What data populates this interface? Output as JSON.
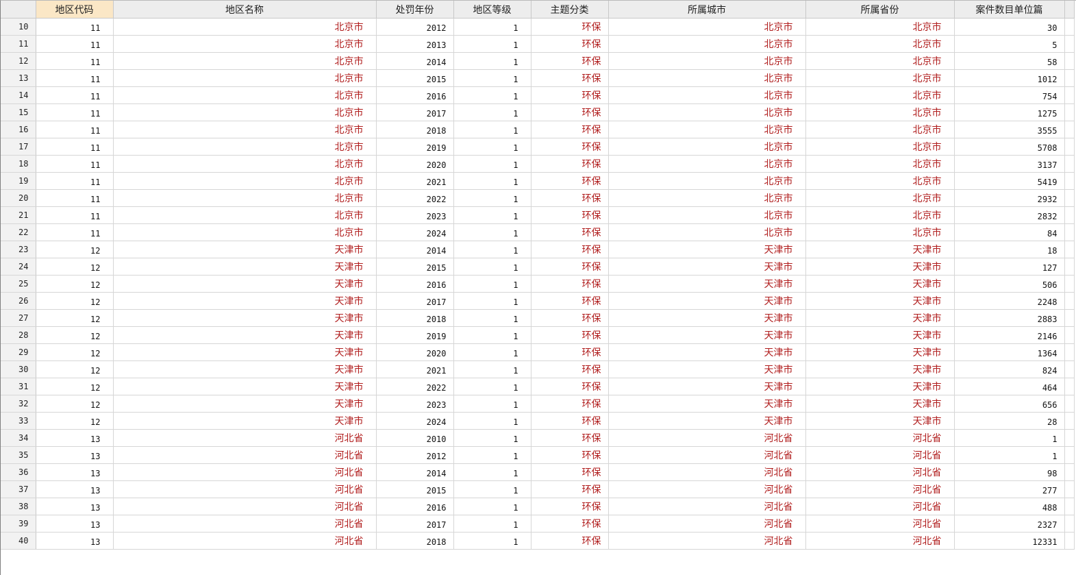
{
  "columns": [
    "地区代码",
    "地区名称",
    "处罚年份",
    "地区等级",
    "主题分类",
    "所属城市",
    "所属省份",
    "案件数目单位篇"
  ],
  "rows": [
    {
      "n": "10",
      "code": "11",
      "name": "北京市",
      "year": "2012",
      "level": "1",
      "theme": "环保",
      "city": "北京市",
      "prov": "北京市",
      "count": "30"
    },
    {
      "n": "11",
      "code": "11",
      "name": "北京市",
      "year": "2013",
      "level": "1",
      "theme": "环保",
      "city": "北京市",
      "prov": "北京市",
      "count": "5"
    },
    {
      "n": "12",
      "code": "11",
      "name": "北京市",
      "year": "2014",
      "level": "1",
      "theme": "环保",
      "city": "北京市",
      "prov": "北京市",
      "count": "58"
    },
    {
      "n": "13",
      "code": "11",
      "name": "北京市",
      "year": "2015",
      "level": "1",
      "theme": "环保",
      "city": "北京市",
      "prov": "北京市",
      "count": "1012"
    },
    {
      "n": "14",
      "code": "11",
      "name": "北京市",
      "year": "2016",
      "level": "1",
      "theme": "环保",
      "city": "北京市",
      "prov": "北京市",
      "count": "754"
    },
    {
      "n": "15",
      "code": "11",
      "name": "北京市",
      "year": "2017",
      "level": "1",
      "theme": "环保",
      "city": "北京市",
      "prov": "北京市",
      "count": "1275"
    },
    {
      "n": "16",
      "code": "11",
      "name": "北京市",
      "year": "2018",
      "level": "1",
      "theme": "环保",
      "city": "北京市",
      "prov": "北京市",
      "count": "3555"
    },
    {
      "n": "17",
      "code": "11",
      "name": "北京市",
      "year": "2019",
      "level": "1",
      "theme": "环保",
      "city": "北京市",
      "prov": "北京市",
      "count": "5708"
    },
    {
      "n": "18",
      "code": "11",
      "name": "北京市",
      "year": "2020",
      "level": "1",
      "theme": "环保",
      "city": "北京市",
      "prov": "北京市",
      "count": "3137"
    },
    {
      "n": "19",
      "code": "11",
      "name": "北京市",
      "year": "2021",
      "level": "1",
      "theme": "环保",
      "city": "北京市",
      "prov": "北京市",
      "count": "5419"
    },
    {
      "n": "20",
      "code": "11",
      "name": "北京市",
      "year": "2022",
      "level": "1",
      "theme": "环保",
      "city": "北京市",
      "prov": "北京市",
      "count": "2932"
    },
    {
      "n": "21",
      "code": "11",
      "name": "北京市",
      "year": "2023",
      "level": "1",
      "theme": "环保",
      "city": "北京市",
      "prov": "北京市",
      "count": "2832"
    },
    {
      "n": "22",
      "code": "11",
      "name": "北京市",
      "year": "2024",
      "level": "1",
      "theme": "环保",
      "city": "北京市",
      "prov": "北京市",
      "count": "84"
    },
    {
      "n": "23",
      "code": "12",
      "name": "天津市",
      "year": "2014",
      "level": "1",
      "theme": "环保",
      "city": "天津市",
      "prov": "天津市",
      "count": "18"
    },
    {
      "n": "24",
      "code": "12",
      "name": "天津市",
      "year": "2015",
      "level": "1",
      "theme": "环保",
      "city": "天津市",
      "prov": "天津市",
      "count": "127"
    },
    {
      "n": "25",
      "code": "12",
      "name": "天津市",
      "year": "2016",
      "level": "1",
      "theme": "环保",
      "city": "天津市",
      "prov": "天津市",
      "count": "506"
    },
    {
      "n": "26",
      "code": "12",
      "name": "天津市",
      "year": "2017",
      "level": "1",
      "theme": "环保",
      "city": "天津市",
      "prov": "天津市",
      "count": "2248"
    },
    {
      "n": "27",
      "code": "12",
      "name": "天津市",
      "year": "2018",
      "level": "1",
      "theme": "环保",
      "city": "天津市",
      "prov": "天津市",
      "count": "2883"
    },
    {
      "n": "28",
      "code": "12",
      "name": "天津市",
      "year": "2019",
      "level": "1",
      "theme": "环保",
      "city": "天津市",
      "prov": "天津市",
      "count": "2146"
    },
    {
      "n": "29",
      "code": "12",
      "name": "天津市",
      "year": "2020",
      "level": "1",
      "theme": "环保",
      "city": "天津市",
      "prov": "天津市",
      "count": "1364"
    },
    {
      "n": "30",
      "code": "12",
      "name": "天津市",
      "year": "2021",
      "level": "1",
      "theme": "环保",
      "city": "天津市",
      "prov": "天津市",
      "count": "824"
    },
    {
      "n": "31",
      "code": "12",
      "name": "天津市",
      "year": "2022",
      "level": "1",
      "theme": "环保",
      "city": "天津市",
      "prov": "天津市",
      "count": "464"
    },
    {
      "n": "32",
      "code": "12",
      "name": "天津市",
      "year": "2023",
      "level": "1",
      "theme": "环保",
      "city": "天津市",
      "prov": "天津市",
      "count": "656"
    },
    {
      "n": "33",
      "code": "12",
      "name": "天津市",
      "year": "2024",
      "level": "1",
      "theme": "环保",
      "city": "天津市",
      "prov": "天津市",
      "count": "28"
    },
    {
      "n": "34",
      "code": "13",
      "name": "河北省",
      "year": "2010",
      "level": "1",
      "theme": "环保",
      "city": "河北省",
      "prov": "河北省",
      "count": "1"
    },
    {
      "n": "35",
      "code": "13",
      "name": "河北省",
      "year": "2012",
      "level": "1",
      "theme": "环保",
      "city": "河北省",
      "prov": "河北省",
      "count": "1"
    },
    {
      "n": "36",
      "code": "13",
      "name": "河北省",
      "year": "2014",
      "level": "1",
      "theme": "环保",
      "city": "河北省",
      "prov": "河北省",
      "count": "98"
    },
    {
      "n": "37",
      "code": "13",
      "name": "河北省",
      "year": "2015",
      "level": "1",
      "theme": "环保",
      "city": "河北省",
      "prov": "河北省",
      "count": "277"
    },
    {
      "n": "38",
      "code": "13",
      "name": "河北省",
      "year": "2016",
      "level": "1",
      "theme": "环保",
      "city": "河北省",
      "prov": "河北省",
      "count": "488"
    },
    {
      "n": "39",
      "code": "13",
      "name": "河北省",
      "year": "2017",
      "level": "1",
      "theme": "环保",
      "city": "河北省",
      "prov": "河北省",
      "count": "2327"
    },
    {
      "n": "40",
      "code": "13",
      "name": "河北省",
      "year": "2018",
      "level": "1",
      "theme": "环保",
      "city": "河北省",
      "prov": "河北省",
      "count": "12331"
    }
  ],
  "colors": {
    "string_text": "#b01c1c",
    "sorted_header": "#fbe7c6",
    "header_bg": "#ededed"
  }
}
